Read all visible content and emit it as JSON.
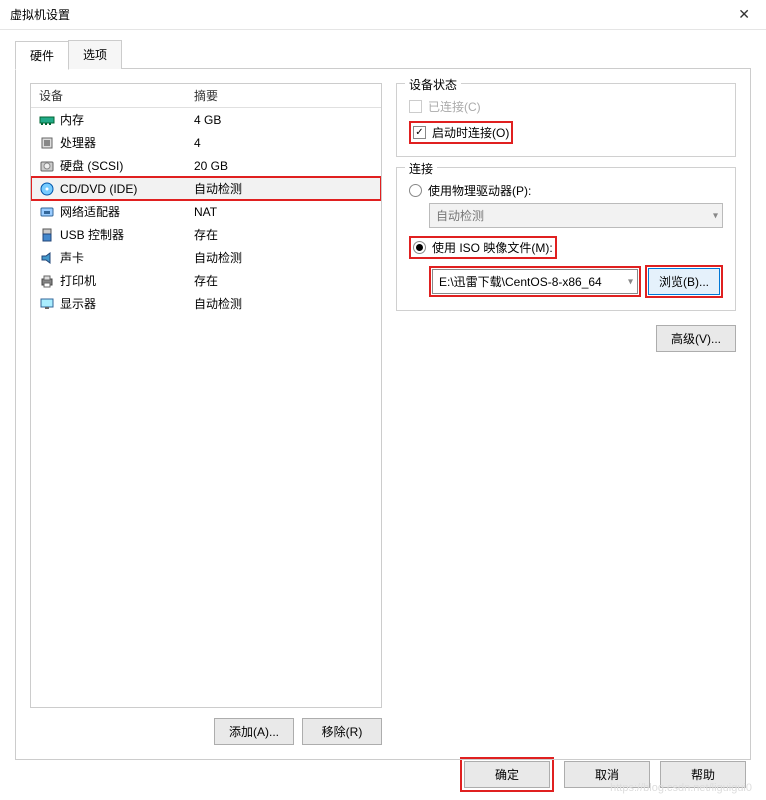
{
  "window": {
    "title": "虚拟机设置"
  },
  "tabs": {
    "hardware": "硬件",
    "options": "选项"
  },
  "hw_header": {
    "device": "设备",
    "summary": "摘要"
  },
  "hw": [
    {
      "icon": "memory",
      "name": "内存",
      "summary": "4 GB"
    },
    {
      "icon": "cpu",
      "name": "处理器",
      "summary": "4"
    },
    {
      "icon": "disk",
      "name": "硬盘 (SCSI)",
      "summary": "20 GB"
    },
    {
      "icon": "disc",
      "name": "CD/DVD (IDE)",
      "summary": "自动检测"
    },
    {
      "icon": "network",
      "name": "网络适配器",
      "summary": "NAT"
    },
    {
      "icon": "usb",
      "name": "USB 控制器",
      "summary": "存在"
    },
    {
      "icon": "sound",
      "name": "声卡",
      "summary": "自动检测"
    },
    {
      "icon": "printer",
      "name": "打印机",
      "summary": "存在"
    },
    {
      "icon": "display",
      "name": "显示器",
      "summary": "自动检测"
    }
  ],
  "left_buttons": {
    "add": "添加(A)...",
    "remove": "移除(R)"
  },
  "status": {
    "legend": "设备状态",
    "connected": "已连接(C)",
    "connect_on_power": "启动时连接(O)"
  },
  "connection": {
    "legend": "连接",
    "use_physical": "使用物理驱动器(P):",
    "physical_value": "自动检测",
    "use_iso": "使用 ISO 映像文件(M):",
    "iso_value": "E:\\迅雷下载\\CentOS-8-x86_64",
    "browse": "浏览(B)..."
  },
  "advanced": "高级(V)...",
  "footer": {
    "ok": "确定",
    "cancel": "取消",
    "help": "帮助"
  },
  "watermark": "https://blog.csdn.net/liguigui0"
}
